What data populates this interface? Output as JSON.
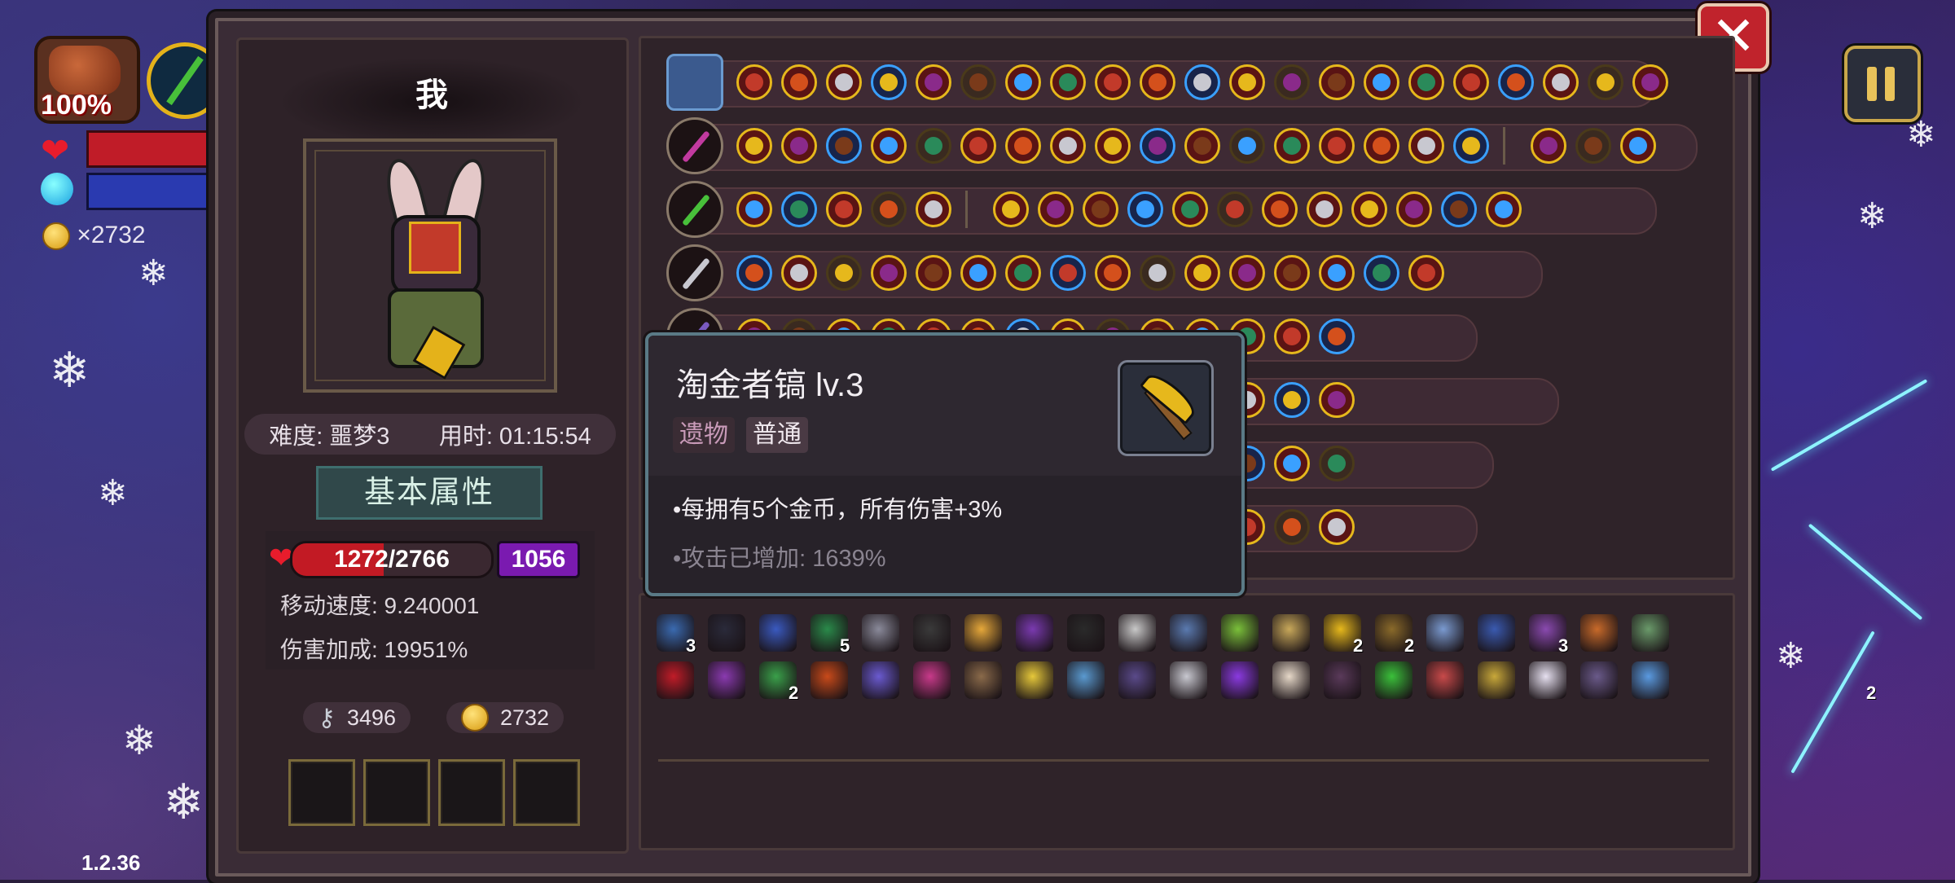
{
  "hud": {
    "hp_percent": "100%",
    "coins": "×2732",
    "version": "1.2.36"
  },
  "player": {
    "name": "我",
    "difficulty": "难度: 噩梦3",
    "time": "用时: 01:15:54",
    "basic_attr": "基本属性",
    "hp": "1272/2766",
    "hp_fraction": 0.46,
    "shield": "1056",
    "move_speed": "移动速度: 9.240001",
    "damage_bonus": "伤害加成: 19951%",
    "keys": "3496",
    "gold": "2732"
  },
  "tooltip": {
    "title": "淘金者镐 lv.3",
    "tag_type": "遗物",
    "tag_rarity": "普通",
    "description": "•每拥有5个金币，所有伤害+3%",
    "extra": "•攻击已增加: 1639%"
  },
  "inventory_counts": {
    "i1": "3",
    "i4": "5",
    "i14": "2",
    "i15": "2",
    "i18": "3",
    "j3": "2",
    "j24": "2"
  },
  "colors": {
    "accent_gold": "#e6b81c",
    "accent_blue": "#3aa0ff",
    "close_red": "#c0232c",
    "shield_purple": "#7a1ab0"
  }
}
